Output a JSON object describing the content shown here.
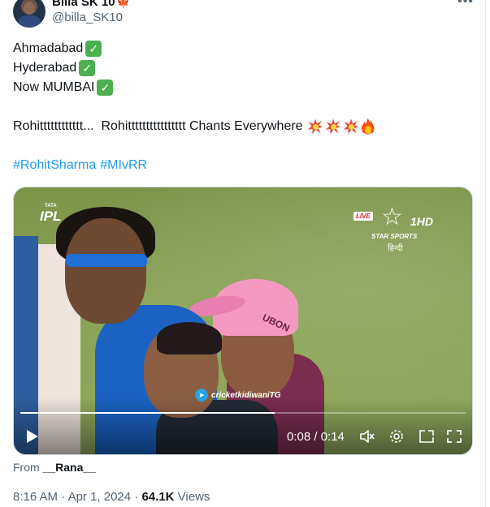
{
  "author": {
    "display_name": "Billa SK 10",
    "flag_emoji": "🍁",
    "handle": "@billa_SK10"
  },
  "more_icon": "more-horizontal-icon",
  "tweet": {
    "line1": "Ahmadabad",
    "line2": "Hyderabad",
    "line3": "Now MUMBAI",
    "line4": "Rohitttttttttttt...  Rohitttttttttttttttt Chants Everywhere",
    "hashtags": [
      "#RohitSharma",
      "#MIvRR"
    ]
  },
  "video": {
    "overlay": {
      "ipl_brand": "TATA",
      "ipl_logo": "IPL",
      "live_badge": "LIVE",
      "channel_hd": "1HD",
      "channel_name": "STAR SPORTS",
      "channel_lang": "हिन्दी",
      "watermark": "cricketkidiwaniTG",
      "cap_text": "UBON"
    },
    "time_display": "0:08 / 0:14",
    "progress_fraction": 0.5714,
    "icons": [
      "play-icon",
      "mute-icon",
      "settings-icon",
      "pip-icon",
      "fullscreen-icon"
    ]
  },
  "attribution": {
    "prefix": "From",
    "source": "__Rana__"
  },
  "meta": {
    "time": "8:16 AM",
    "date": "Apr 1, 2024",
    "views_count": "64.1K",
    "views_label": "Views"
  },
  "colors": {
    "link": "#1d9bf0",
    "secondary_text": "#536471",
    "primary_text": "#0f1419"
  }
}
